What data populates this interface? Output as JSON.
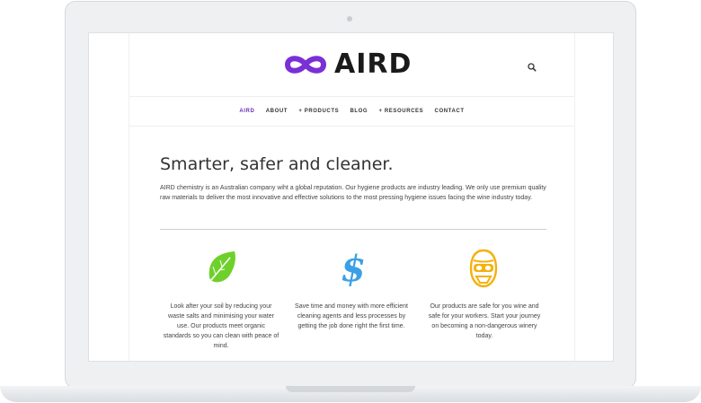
{
  "header": {
    "logo_text": "AIRD"
  },
  "nav": {
    "items": [
      "AIRD",
      "ABOUT",
      "+ PRODUCTS",
      "BLOG",
      "+ RESOURCES",
      "CONTACT"
    ]
  },
  "main": {
    "headline": "Smarter, safer and cleaner.",
    "intro": "AIRD chemistry is an Australian company wiht a global reputation.  Our hygiene products are industry leading.  We only use premium quality raw materials to deliver the most innovative and effective solutions to the most pressing hygiene issues facing the wine industry today.",
    "features": [
      {
        "icon": "leaf-icon",
        "text": "Look after your soil by reducing your waste salts and minimising your water use.  Our products meet organic standards so you can clean with peace of mind."
      },
      {
        "icon": "dollar-icon",
        "text": "Save time and money with more efficient cleaning agents and less processes by getting the job done right the first time."
      },
      {
        "icon": "safety-mask-icon",
        "text": "Our products are safe for you wine and safe for your workers.  Start your journey on becoming a non-dangerous winery today."
      }
    ]
  },
  "colors": {
    "brand_purple": "#7b2fd6",
    "leaf_green": "#6ed12b",
    "dollar_blue": "#3aa0e6",
    "mask_yellow": "#f5b10c"
  }
}
